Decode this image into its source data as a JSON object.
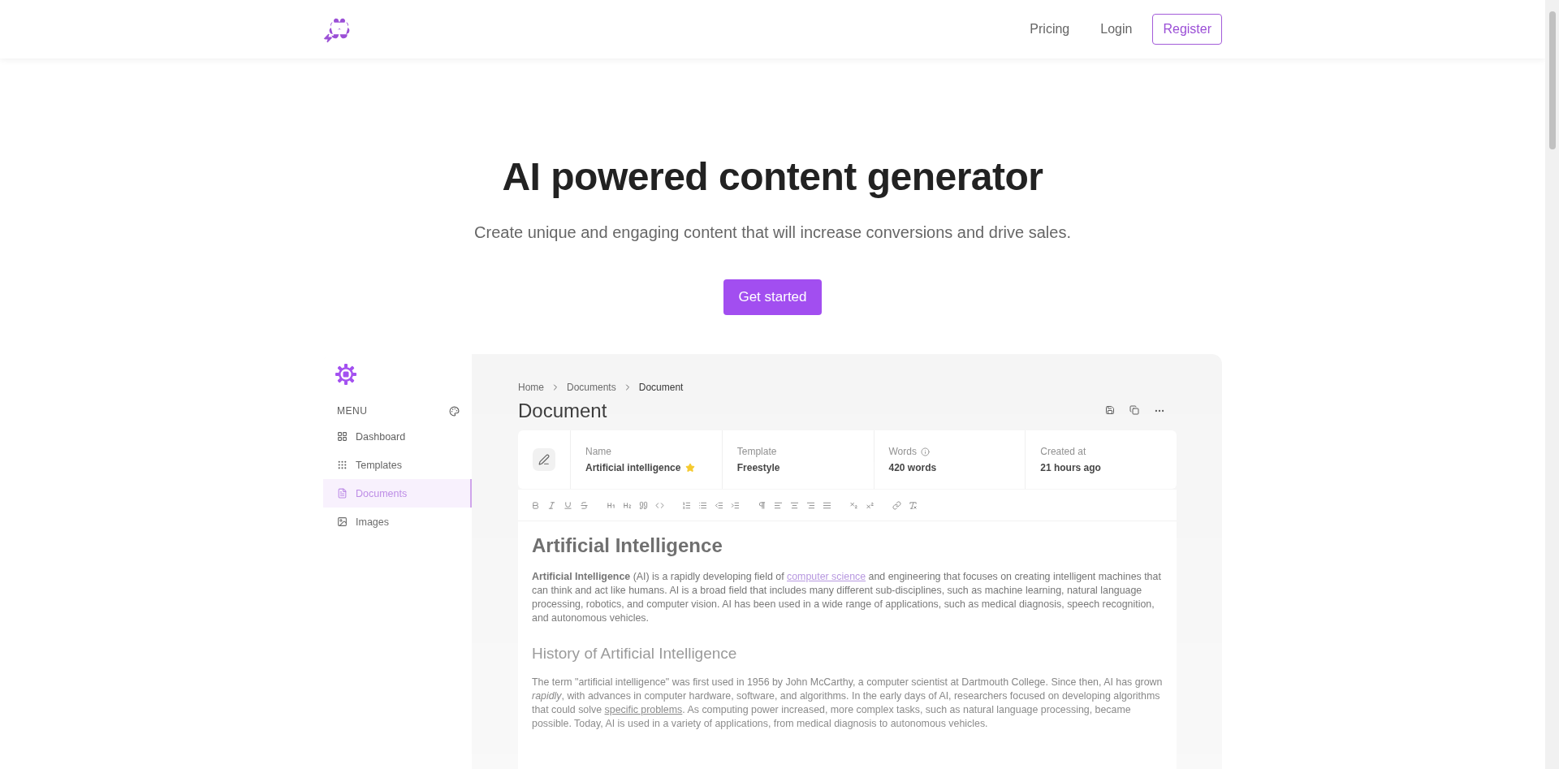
{
  "nav": {
    "links": [
      {
        "label": "Pricing",
        "kind": "link"
      },
      {
        "label": "Login",
        "kind": "link"
      },
      {
        "label": "Register",
        "kind": "outline"
      }
    ]
  },
  "hero": {
    "title": "AI powered content generator",
    "subtitle": "Create unique and engaging content that will increase conversions and drive sales.",
    "cta": "Get started"
  },
  "app": {
    "sidebar": {
      "heading": "MENU",
      "items": [
        {
          "label": "Dashboard",
          "selected": false
        },
        {
          "label": "Templates",
          "selected": false
        },
        {
          "label": "Documents",
          "selected": true
        },
        {
          "label": "Images",
          "selected": false
        }
      ]
    },
    "breadcrumb": [
      "Home",
      "Documents",
      "Document"
    ],
    "title": "Document",
    "info": [
      {
        "label": "Name",
        "value": "Artificial intelligence",
        "starred": true
      },
      {
        "label": "Template",
        "value": "Freestyle"
      },
      {
        "label": "Words",
        "value": "420 words",
        "info": true
      },
      {
        "label": "Created at",
        "value": "21 hours ago"
      }
    ],
    "content": [
      {
        "kind": "h1",
        "text": "Artificial Intelligence"
      },
      {
        "kind": "p",
        "segments": [
          {
            "kind": "text",
            "text": "**Artificial Intelligence** (AI) is a rapidly developing field of "
          },
          {
            "kind": "link",
            "text": "computer science"
          },
          {
            "kind": "text",
            "text": " and engineering that focuses on creating intelligent machines that can think and act like humans. AI is a broad field that includes many different sub-disciplines, such as machine learning, natural language processing, robotics, and computer vision. AI has been used in a wide range of applications, such as medical diagnosis, speech recognition, and autonomous vehicles."
          }
        ]
      },
      {
        "kind": "h2",
        "text": "History of Artificial Intelligence"
      },
      {
        "kind": "p",
        "segments": [
          {
            "kind": "text",
            "text": "The term \"artificial intelligence\" was first used in 1956 by John McCarthy, a computer scientist at Dartmouth College. Since then, AI has grown *rapidly*, with advances in computer hardware, software, and algorithms. In the early days of AI, researchers focused on developing algorithms that could solve "
          },
          {
            "kind": "underline",
            "text": "specific problems"
          },
          {
            "kind": "text",
            "text": ". As computing power increased, more complex tasks, such as natural language processing, became possible. Today, AI is used in a variety of applications, from medical diagnosis to autonomous vehicles."
          }
        ]
      }
    ]
  }
}
